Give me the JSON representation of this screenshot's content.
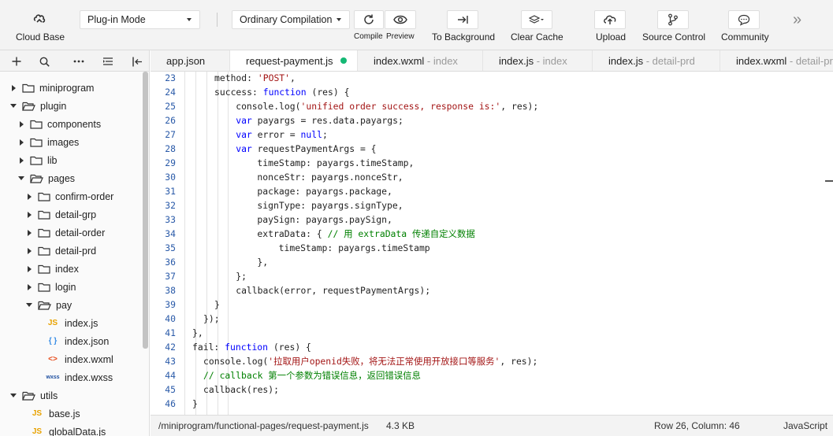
{
  "toolbar": {
    "cloud_base": "Cloud Base",
    "mode_select": "Plug-in Mode",
    "compile_select": "Ordinary Compilation",
    "compile_label": "Compile",
    "preview_label": "Preview",
    "to_background": "To Background",
    "clear_cache": "Clear Cache",
    "upload": "Upload",
    "source_control": "Source Control",
    "community": "Community",
    "more": "»"
  },
  "explorer": {
    "items": [
      {
        "label": "miniprogram",
        "kind": "folder",
        "open": false,
        "depth": 0
      },
      {
        "label": "plugin",
        "kind": "folder",
        "open": true,
        "depth": 0
      },
      {
        "label": "components",
        "kind": "folder",
        "open": false,
        "depth": 1
      },
      {
        "label": "images",
        "kind": "folder",
        "open": false,
        "depth": 1
      },
      {
        "label": "lib",
        "kind": "folder",
        "open": false,
        "depth": 1
      },
      {
        "label": "pages",
        "kind": "folder",
        "open": true,
        "depth": 1
      },
      {
        "label": "confirm-order",
        "kind": "folder",
        "open": false,
        "depth": 2
      },
      {
        "label": "detail-grp",
        "kind": "folder",
        "open": false,
        "depth": 2
      },
      {
        "label": "detail-order",
        "kind": "folder",
        "open": false,
        "depth": 2
      },
      {
        "label": "detail-prd",
        "kind": "folder",
        "open": false,
        "depth": 2
      },
      {
        "label": "index",
        "kind": "folder",
        "open": false,
        "depth": 2
      },
      {
        "label": "login",
        "kind": "folder",
        "open": false,
        "depth": 2
      },
      {
        "label": "pay",
        "kind": "folder",
        "open": true,
        "depth": 2
      },
      {
        "label": "index.js",
        "kind": "js",
        "badge": "JS",
        "depth": 3
      },
      {
        "label": "index.json",
        "kind": "json",
        "badge": "{ }",
        "depth": 3
      },
      {
        "label": "index.wxml",
        "kind": "wxml",
        "badge": "<>",
        "depth": 3
      },
      {
        "label": "index.wxss",
        "kind": "wxss",
        "badge": "wxss",
        "depth": 3
      },
      {
        "label": "utils",
        "kind": "folder",
        "open": true,
        "depth": 0
      },
      {
        "label": "base.js",
        "kind": "js",
        "badge": "JS",
        "depth": 1
      },
      {
        "label": "globalData.js",
        "kind": "js",
        "badge": "JS",
        "depth": 1
      }
    ]
  },
  "tabs": [
    {
      "name": "app.json",
      "sub": ""
    },
    {
      "name": "request-payment.js",
      "sub": "",
      "active": true,
      "modified": true
    },
    {
      "name": "index.wxml",
      "sub": " - index"
    },
    {
      "name": "index.js",
      "sub": " - index"
    },
    {
      "name": "index.js",
      "sub": " - detail-prd"
    },
    {
      "name": "index.wxml",
      "sub": " - detail-prd"
    }
  ],
  "editor": {
    "lines": [
      {
        "n": "23",
        "html": "method: <span class=\"s\">'POST'</span>,"
      },
      {
        "n": "24",
        "html": "success: <span class=\"k\">function</span> (res) {"
      },
      {
        "n": "25",
        "html": "  console.log(<span class=\"s\">'unified order success, response is:'</span>, res);"
      },
      {
        "n": "26",
        "html": "  <span class=\"k\">var</span> payargs = res.data.payargs;"
      },
      {
        "n": "27",
        "html": "  <span class=\"k\">var</span> error = <span class=\"k\">null</span>;"
      },
      {
        "n": "28",
        "html": "  <span class=\"k\">var</span> requestPaymentArgs = {"
      },
      {
        "n": "29",
        "html": "    timeStamp: payargs.timeStamp,"
      },
      {
        "n": "30",
        "html": "    nonceStr: payargs.nonceStr,"
      },
      {
        "n": "31",
        "html": "    package: payargs.package,"
      },
      {
        "n": "32",
        "html": "    signType: payargs.signType,"
      },
      {
        "n": "33",
        "html": "    paySign: payargs.paySign,"
      },
      {
        "n": "34",
        "html": "    extraData: { <span class=\"c\">// 用 extraData 传递自定义数据</span>"
      },
      {
        "n": "35",
        "html": "      timeStamp: payargs.timeStamp"
      },
      {
        "n": "36",
        "html": "    },"
      },
      {
        "n": "37",
        "html": "  };"
      },
      {
        "n": "38",
        "html": "  callback(error, requestPaymentArgs);"
      },
      {
        "n": "39",
        "html": "}"
      },
      {
        "n": "40",
        "html": "<span style=\"margin-left:-14px\">});</span>"
      },
      {
        "n": "41",
        "html": "<span style=\"margin-left:-28px\">},</span>"
      },
      {
        "n": "42",
        "html": "<span style=\"margin-left:-28px\">fail: <span class=\"k\">function</span> (res) {</span>"
      },
      {
        "n": "43",
        "html": "<span style=\"margin-left:-14px\">console.log(<span class=\"s\">'拉取用户openid失败，将无法正常使用开放接口等服务'</span>, res);</span>"
      },
      {
        "n": "44",
        "html": "<span style=\"margin-left:-14px\"><span class=\"c\">// callback 第一个参数为错误信息，返回错误信息</span></span>"
      },
      {
        "n": "45",
        "html": "<span style=\"margin-left:-14px\">callback(res);</span>"
      },
      {
        "n": "46",
        "html": "<span style=\"margin-left:-28px\">}</span>"
      }
    ]
  },
  "statusbar": {
    "path": "/miniprogram/functional-pages/request-payment.js",
    "size": "4.3 KB",
    "position": "Row 26, Column: 46",
    "language": "JavaScript"
  }
}
